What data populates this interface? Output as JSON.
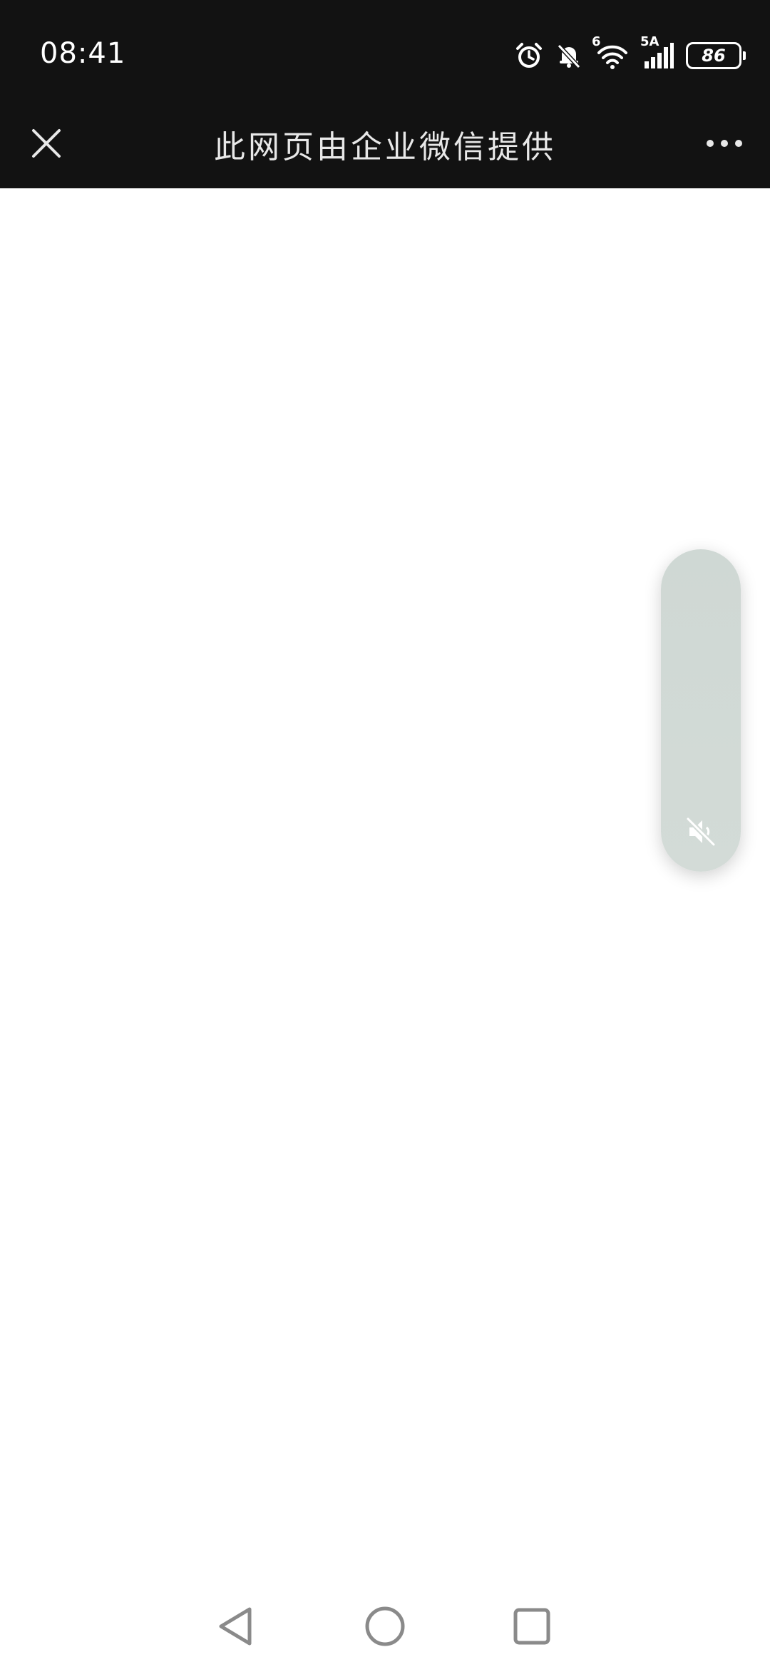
{
  "status_bar": {
    "time": "08:41",
    "battery_level": "86",
    "icons": [
      "alarm-icon",
      "bell-muted-icon",
      "wifi-icon",
      "signal-icon",
      "battery-icon"
    ],
    "wifi_label": "6",
    "signal_label": "5A"
  },
  "title_bar": {
    "title": "此网页由企业微信提供",
    "close_icon": "close-icon",
    "more_icon": "more-dots-icon"
  },
  "floating_panel": {
    "mute_icon": "speaker-muted-icon",
    "color": "#cfd8d4"
  },
  "nav_bar": {
    "buttons": [
      "back-icon",
      "home-icon",
      "recent-apps-icon"
    ]
  },
  "colors": {
    "header_bg": "#121212",
    "content_bg": "#ffffff",
    "nav_icon": "#8a8a8a"
  }
}
